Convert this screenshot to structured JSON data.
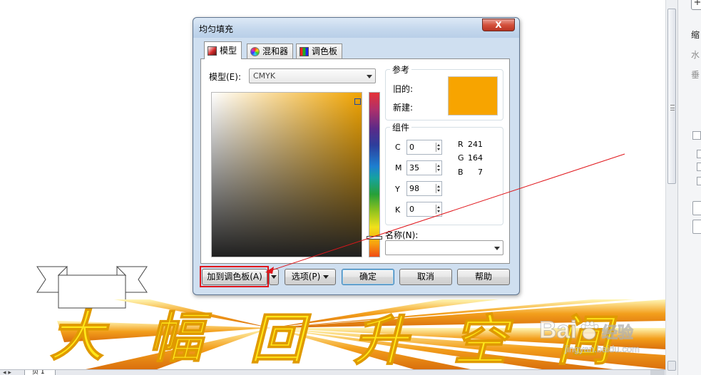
{
  "dialog": {
    "title": "均匀填充",
    "close_label": "X",
    "tabs": [
      {
        "label": "模型",
        "active": true,
        "icon": "model-icon"
      },
      {
        "label": "混和器",
        "active": false,
        "icon": "mixer-icon"
      },
      {
        "label": "调色板",
        "active": false,
        "icon": "palette-icon"
      }
    ],
    "model_label": "模型(E):",
    "model_value": "CMYK",
    "reference": {
      "title": "参考",
      "old_label": "旧的:",
      "new_label": "新建:",
      "swatch_color": "#F7A400"
    },
    "components": {
      "title": "组件",
      "cmyk": [
        {
          "label": "C",
          "value": "0"
        },
        {
          "label": "M",
          "value": "35"
        },
        {
          "label": "Y",
          "value": "98"
        },
        {
          "label": "K",
          "value": "0"
        }
      ],
      "rgb": [
        {
          "label": "R",
          "value": "241"
        },
        {
          "label": "G",
          "value": "164"
        },
        {
          "label": "B",
          "value": "7"
        }
      ]
    },
    "name_label": "名称(N):",
    "name_value": "",
    "buttons": {
      "add_to_palette": "加到调色板(A)",
      "options": "选项(P)",
      "ok": "确定",
      "cancel": "取消",
      "help": "帮助"
    }
  },
  "canvas": {
    "title_art_text": "大幅回升空间",
    "title_art_color": "#FFE81A",
    "burst_color": "#F27B00",
    "watermark_text": "Baidu经验",
    "watermark_sub": "jingyan.baidu.com"
  },
  "side_panel": {
    "label_top": "缩",
    "label_h": "水",
    "label_v": "垂"
  },
  "status_bar": {
    "page_tab": "页 1"
  },
  "colors": {
    "annotation_red": "#E0161B",
    "dialog_frame": "#CFDFF0"
  }
}
